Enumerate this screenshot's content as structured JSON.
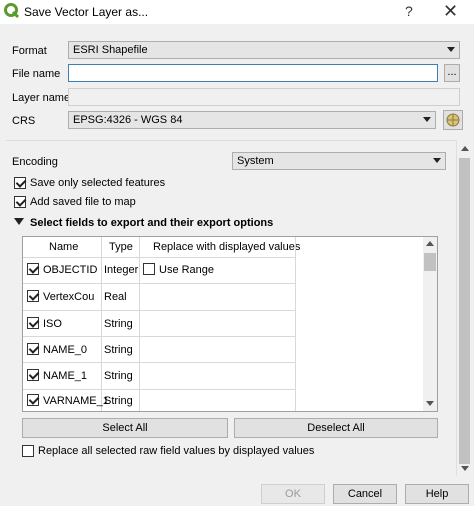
{
  "window": {
    "title": "Save Vector Layer as...",
    "help_glyph": "?",
    "close_glyph": "✕"
  },
  "form": {
    "format_label": "Format",
    "format_value": "ESRI Shapefile",
    "filename_label": "File name",
    "filename_value": "",
    "browse_label": "...",
    "layername_label": "Layer name",
    "crs_label": "CRS",
    "crs_value": "EPSG:4326 - WGS 84"
  },
  "options": {
    "encoding_label": "Encoding",
    "encoding_value": "System",
    "save_selected_label": "Save only selected features",
    "save_selected_checked": true,
    "add_to_map_label": "Add saved file to map",
    "add_to_map_checked": true,
    "fields_section_label": "Select fields to export and their export options"
  },
  "fields_table": {
    "headers": {
      "name": "Name",
      "type": "Type",
      "replace": "Replace with displayed values"
    },
    "use_range_label": "Use Range",
    "rows": [
      {
        "name": "OBJECTID",
        "type": "Integer",
        "checked": true
      },
      {
        "name": "VertexCou",
        "type": "Real",
        "checked": true
      },
      {
        "name": "ISO",
        "type": "String",
        "checked": true
      },
      {
        "name": "NAME_0",
        "type": "String",
        "checked": true
      },
      {
        "name": "NAME_1",
        "type": "String",
        "checked": true
      },
      {
        "name": "VARNAME_1",
        "type": "String",
        "checked": true
      }
    ]
  },
  "actions": {
    "select_all": "Select All",
    "deselect_all": "Deselect All",
    "replace_all_label": "Replace all selected raw field values by displayed values",
    "replace_all_checked": false
  },
  "footer": {
    "ok": "OK",
    "cancel": "Cancel",
    "help": "Help"
  },
  "colors": {
    "qgis_green": "#5a9b31",
    "focus_border": "#3c7fb1"
  }
}
